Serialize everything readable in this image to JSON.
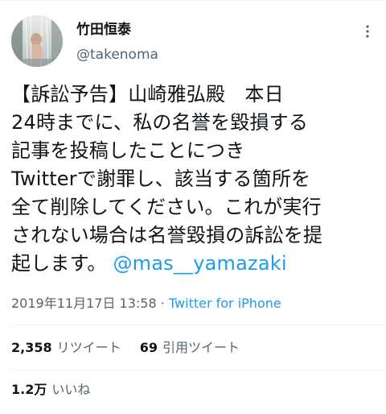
{
  "author": {
    "display_name": "竹田恒泰",
    "handle": "@takenoma"
  },
  "tweet": {
    "text": "【訴訟予告】山崎雅弘殿　本日\n24時までに、私の名誉を毀損する\n記事を投稿したことにつき\nTwitterで謝罪し、該当する箇所を\n全て削除してください。これが実行\nされない場合は名誉毀損の訴訟を提\n起します。",
    "mention": "@mas__yamazaki"
  },
  "meta": {
    "timestamp": "2019年11月17日 13:58",
    "separator": " · ",
    "source": "Twitter for iPhone"
  },
  "stats": {
    "retweets_count": "2,358",
    "retweets_label": "リツイート",
    "quotes_count": "69",
    "quotes_label": "引用ツイート",
    "likes_count": "1.2万",
    "likes_label": "いいね"
  },
  "icons": {
    "more": "more-vertical-icon"
  },
  "colors": {
    "text": "#0f1419",
    "secondary": "#536471",
    "link": "#1d9bf0",
    "divider": "#eff3f4"
  }
}
